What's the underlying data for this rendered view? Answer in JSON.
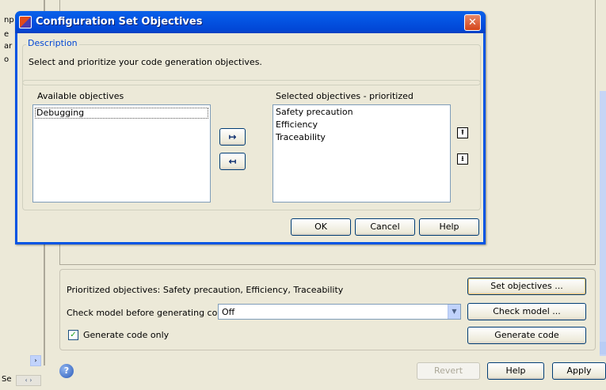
{
  "dialog": {
    "title": "Configuration Set Objectives",
    "close_glyph": "✕",
    "description_legend": "Description",
    "description_text": "Select and prioritize your code generation objectives.",
    "available_label": "Available objectives",
    "available_items": [
      "Debugging"
    ],
    "selected_label": "Selected objectives - prioritized",
    "selected_items": [
      "Safety precaution",
      "Efficiency",
      "Traceability"
    ],
    "move_right_glyph": "↦",
    "move_left_glyph": "↤",
    "priority_up_glyph": "⭱",
    "priority_down_glyph": "⭳",
    "ok_label": "OK",
    "cancel_label": "Cancel",
    "help_label": "Help"
  },
  "panel": {
    "prioritized_text": "Prioritized objectives:  Safety precaution, Efficiency, Traceability",
    "set_objectives_label": "Set objectives ...",
    "check_model_label": "Check model before generating code:",
    "check_model_value": "Off",
    "check_model_button": "Check model ...",
    "generate_only_checked": true,
    "generate_only_label": "Generate code only",
    "generate_code_button": "Generate code"
  },
  "footer": {
    "help_icon_glyph": "?",
    "revert_label": "Revert",
    "help_label": "Help",
    "apply_label": "Apply"
  },
  "left_fragments": [
    "np",
    "e",
    "ar",
    "o"
  ],
  "left_bottom_text": "Se",
  "icons": {
    "checkbox_check": "✓",
    "dropdown_arrow": "▼",
    "scroll_right": "›",
    "scroll_pair": "‹ ›"
  },
  "colors": {
    "titlebar_blue": "#0054e3",
    "legend_blue": "#0046d5",
    "close_red": "#d4451a",
    "window_bg": "#ece9d8"
  }
}
